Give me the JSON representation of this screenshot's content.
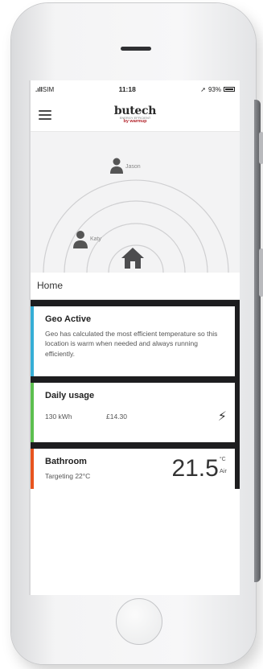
{
  "status": {
    "signal": "SIM",
    "time": "11:18",
    "battery": "93%"
  },
  "header": {
    "brand": "butech",
    "tagline": "ENERGY EFFICIENT",
    "sub": "by warmup"
  },
  "geo": {
    "people": [
      "Jason",
      "Katy"
    ]
  },
  "home": {
    "title": "Home"
  },
  "cards": {
    "geo": {
      "title": "Geo Active",
      "text": "Geo has calculated the most efficient temperature so this location is warm when needed and always running efficiently."
    },
    "usage": {
      "title": "Daily usage",
      "kwh": "130 kWh",
      "cost": "£14.30"
    },
    "bathroom": {
      "title": "Bathroom",
      "target": "Targeting 22°C",
      "temp": "21.5",
      "unit": "°C",
      "mode": "Air"
    }
  },
  "colors": {
    "geo_accent": "#36aed6",
    "usage_accent": "#5cbf4f",
    "bathroom_accent": "#e8541e",
    "brand_red": "#b2232a"
  },
  "icons": [
    "menu-icon",
    "person-icon",
    "house-icon",
    "lightning-bolt-icon",
    "location-arrow-icon",
    "battery-icon"
  ]
}
